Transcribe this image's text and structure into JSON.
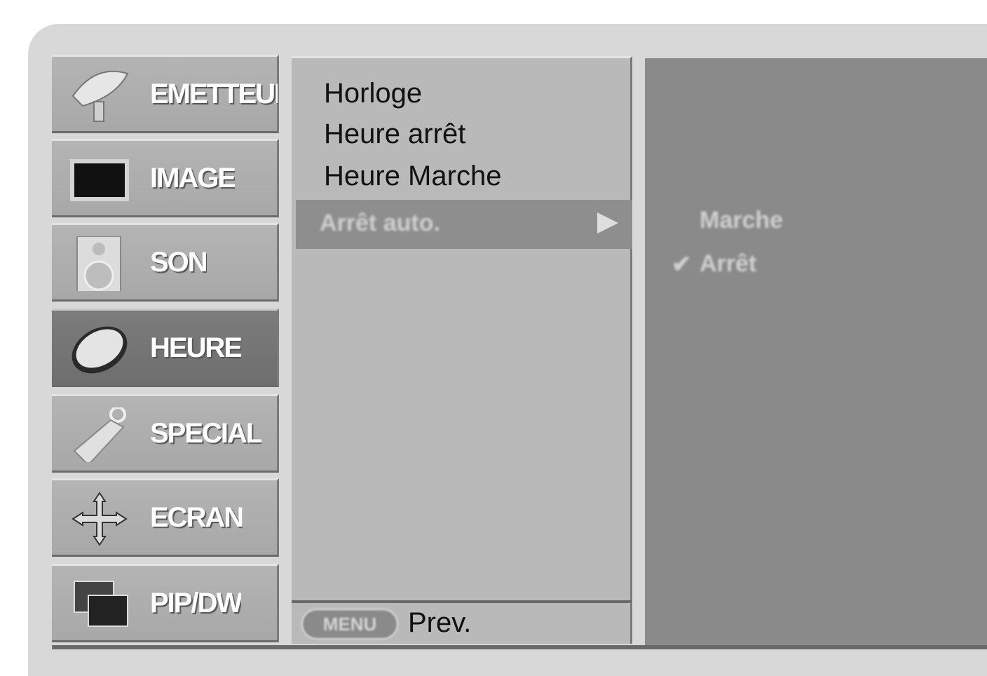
{
  "categories": [
    {
      "label": "EMETTEUR",
      "icon": "satellite-dish-icon",
      "active": false
    },
    {
      "label": "IMAGE",
      "icon": "tv-screen-icon",
      "active": false
    },
    {
      "label": "SON",
      "icon": "speaker-icon",
      "active": false
    },
    {
      "label": "HEURE",
      "icon": "clock-icon",
      "active": true
    },
    {
      "label": "SPECIAL",
      "icon": "key-tag-icon",
      "active": false
    },
    {
      "label": "ECRAN",
      "icon": "four-arrows-icon",
      "active": false
    },
    {
      "label": "PIP/DW",
      "icon": "pip-windows-icon",
      "active": false
    }
  ],
  "submenu": {
    "items": [
      "Horloge",
      "Heure arrêt",
      "Heure Marche"
    ],
    "highlighted": "Arrêt auto."
  },
  "options": [
    "Marche",
    "Arrêt"
  ],
  "footer": {
    "button_label": "MENU",
    "prev_label": "Prev."
  }
}
